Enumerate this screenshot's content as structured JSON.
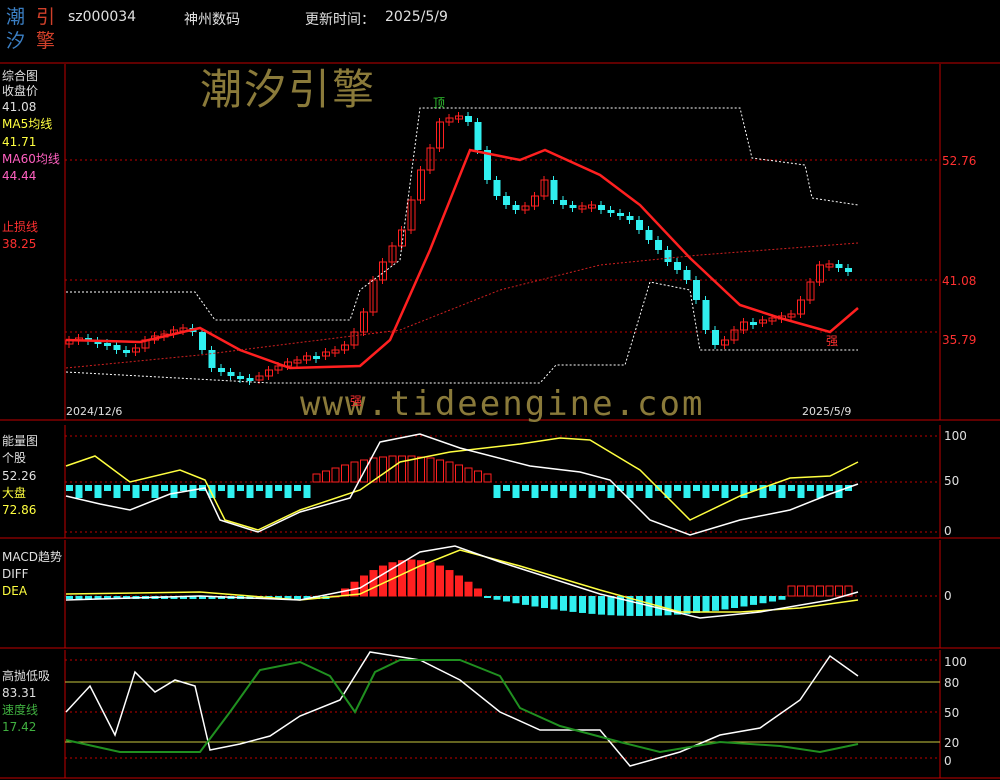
{
  "header": {
    "logo_chars": [
      "潮",
      "引",
      "汐",
      "擎"
    ],
    "code": "sz000034",
    "name": "神州数码",
    "update_label": "更新时间：",
    "update_value": "2025/5/9"
  },
  "watermarks": {
    "cn": "潮汐引擎",
    "url": "www.tideengine.com"
  },
  "colors": {
    "up": "#ff2020",
    "down": "#30f0f0",
    "ma": "#ff2020",
    "ma60": "#ff4040",
    "yellow": "#ffff40",
    "white": "#ffffff",
    "green": "#20a020",
    "grid": "#c00000"
  },
  "panel_main": {
    "title": "综合图",
    "labels": [
      {
        "name": "收盘价",
        "value": "41.08"
      },
      {
        "name": "MA5均线",
        "value": "41.71"
      },
      {
        "name": "MA60均线",
        "value": "44.44"
      },
      {
        "name": "止损线",
        "value": "38.25"
      }
    ],
    "right_axis": [
      "52.76",
      "41.08",
      "35.79"
    ],
    "date_start": "2024/12/6",
    "date_end": "2025/5/9",
    "marks": {
      "top": "顶",
      "strong1": "强",
      "strong2": "强"
    }
  },
  "panel_energy": {
    "title": "能量图",
    "labels": [
      {
        "name": "个股",
        "value": "52.26"
      },
      {
        "name": "大盘",
        "value": "72.86"
      }
    ],
    "right_axis": [
      "100",
      "50",
      "0"
    ]
  },
  "panel_macd": {
    "title": "MACD趋势",
    "labels": [
      {
        "name": "DIFF"
      },
      {
        "name": "DEA"
      }
    ],
    "right_axis": [
      "0"
    ]
  },
  "panel_osc": {
    "title": "高抛低吸",
    "labels": [
      {
        "name": "",
        "value": "83.31"
      },
      {
        "name": "速度线",
        "value": "17.42"
      }
    ],
    "right_axis": [
      "100",
      "80",
      "50",
      "20",
      "0"
    ]
  }
}
